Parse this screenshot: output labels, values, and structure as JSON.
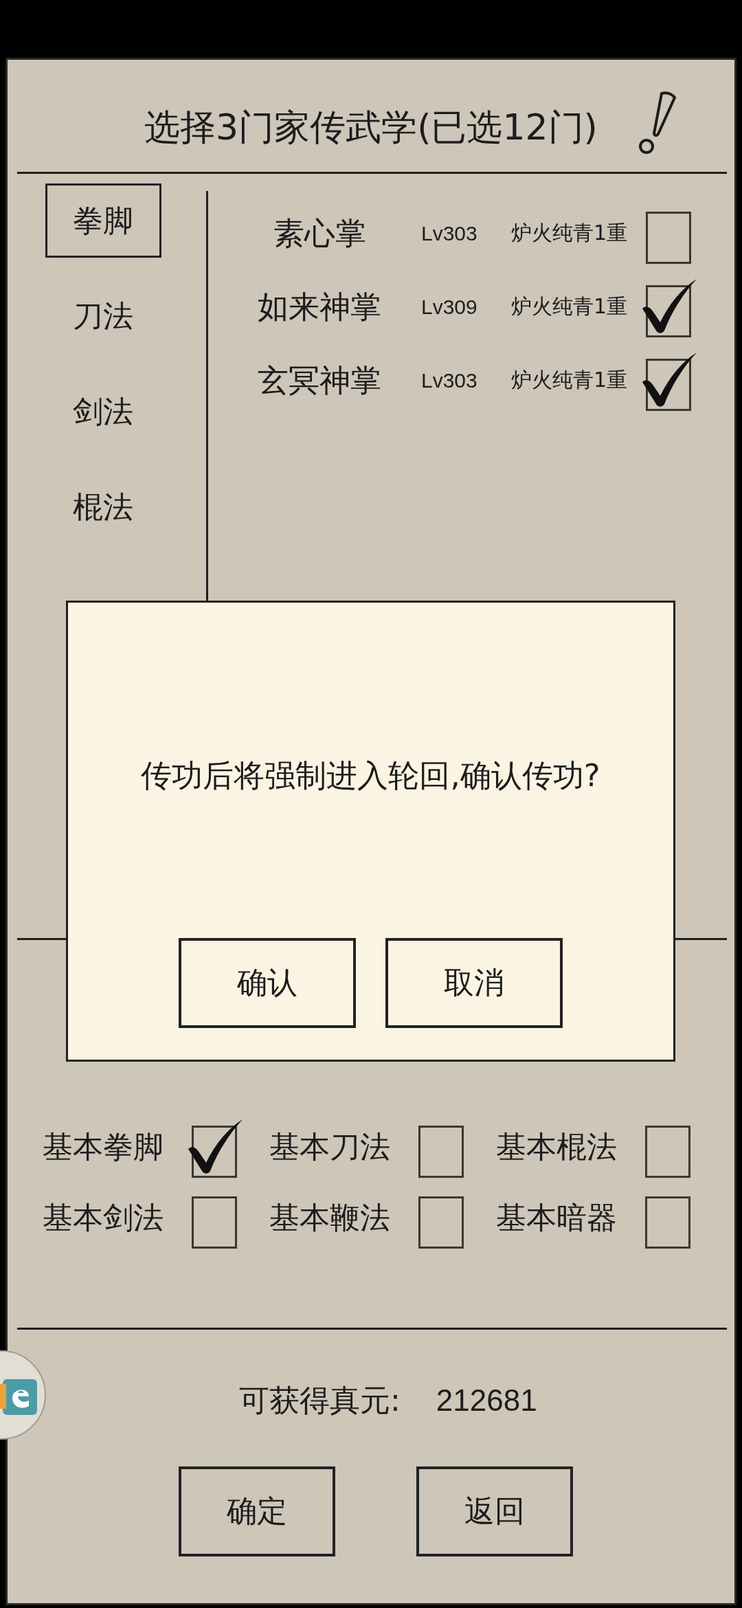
{
  "header": {
    "title": "选择3门家传武学(已选12门)"
  },
  "categories": [
    {
      "label": "拳脚",
      "selected": true
    },
    {
      "label": "刀法",
      "selected": false
    },
    {
      "label": "剑法",
      "selected": false
    },
    {
      "label": "棍法",
      "selected": false
    }
  ],
  "skills": [
    {
      "name": "素心掌",
      "lv": "Lv303",
      "rank": "炉火纯青1重",
      "checked": false
    },
    {
      "name": "如来神掌",
      "lv": "Lv309",
      "rank": "炉火纯青1重",
      "checked": true
    },
    {
      "name": "玄冥神掌",
      "lv": "Lv303",
      "rank": "炉火纯青1重",
      "checked": true
    }
  ],
  "basics": [
    {
      "label": "基本拳脚",
      "checked": true
    },
    {
      "label": "基本刀法",
      "checked": false
    },
    {
      "label": "基本棍法",
      "checked": false
    },
    {
      "label": "基本剑法",
      "checked": false
    },
    {
      "label": "基本鞭法",
      "checked": false
    },
    {
      "label": "基本暗器",
      "checked": false
    }
  ],
  "reward": {
    "label": "可获得真元:",
    "value": "212681"
  },
  "buttons": [
    "确定",
    "返回"
  ],
  "dialog": {
    "message": "传功后将强制进入轮回,确认传功?",
    "buttons": [
      "确认",
      "取消"
    ]
  }
}
